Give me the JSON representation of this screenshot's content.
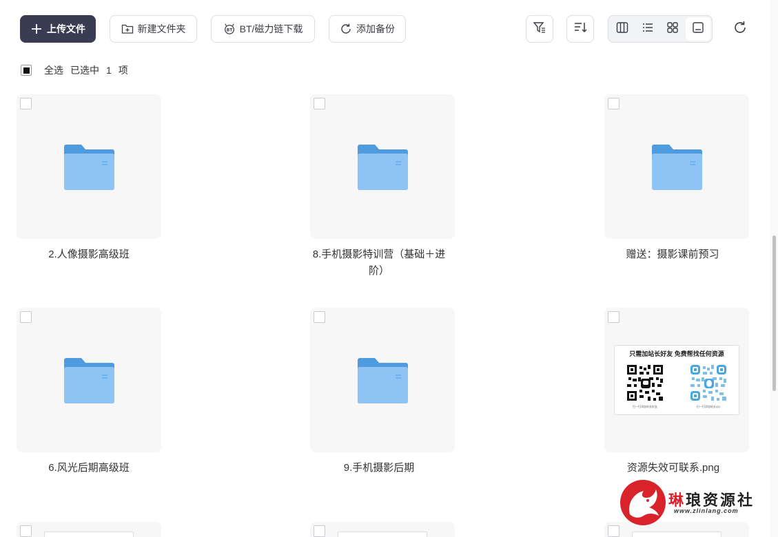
{
  "toolbar": {
    "upload_label": "上传文件",
    "new_folder_label": "新建文件夹",
    "bt_label": "BT/磁力链下载",
    "backup_label": "添加备份"
  },
  "selection": {
    "select_all": "全选",
    "selected_prefix": "已选中",
    "selected_count": "1",
    "selected_suffix": "项"
  },
  "files": [
    {
      "name": "2.人像摄影高级班",
      "type": "folder"
    },
    {
      "name": "8.手机摄影特训营（基础＋进阶）",
      "type": "folder"
    },
    {
      "name": "赠送：摄影课前预习",
      "type": "folder"
    },
    {
      "name": "6.风光后期高级班",
      "type": "folder"
    },
    {
      "name": "9.手机摄影后期",
      "type": "folder"
    },
    {
      "name": "资源失效可联系.png",
      "type": "image"
    }
  ],
  "qr_image": {
    "caption": "只需加站长好友  免费帮找任何资源",
    "left_sub": "扫一扫添加站长好友",
    "right_sub": "扫一扫添加站长QQ"
  },
  "watermark": {
    "title_first": "琳",
    "title_rest": "琅资源社",
    "url": "www.zlinlang.com"
  },
  "colors": {
    "primary_button": "#3a3d52",
    "folder": "#5aa8ea",
    "watermark_red": "#d8232a"
  }
}
